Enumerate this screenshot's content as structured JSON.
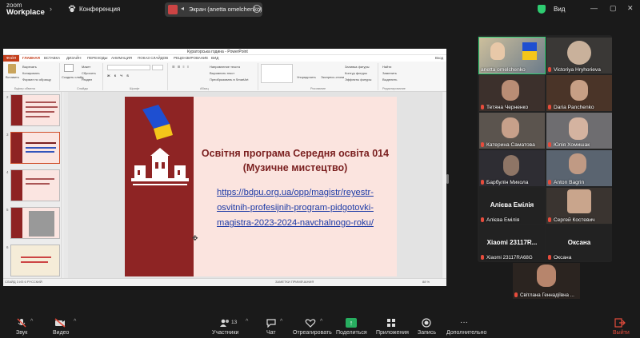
{
  "app": {
    "logo_line1": "zoom",
    "logo_line2": "Workplace",
    "conference_label": "Конференция",
    "share_label": "Экран (anetta omelchenko)",
    "view_label": "Вид",
    "accent_green": "#2ecc71",
    "leave_color": "#e74c3c"
  },
  "ppt": {
    "window_title": "Кураторська година - PowerPoint",
    "file_tab": "ФАЙЛ",
    "tabs": [
      "ГЛАВНАЯ",
      "ВСТАВКА",
      "ДИЗАЙН",
      "ПЕРЕХОДЫ",
      "АНИМАЦИЯ",
      "ПОКАЗ СЛАЙДОВ",
      "РЕЦЕНЗИРОВАНИЕ",
      "ВИД"
    ],
    "signin": "Вход",
    "ribbon": {
      "paste": "Вставить",
      "cut": "Вырезать",
      "copy": "Копировать",
      "format": "Формат по образцу",
      "new_slide": "Создать слайд",
      "layout": "Макет",
      "reset": "Сбросить",
      "section": "Раздел",
      "text_dir": "Направление текста",
      "align_text": "Выровнять текст",
      "smartart": "Преобразовать в SmartArt",
      "arrange": "Упорядочить",
      "quick_styles": "Экспресс-стили",
      "shape_fill": "Заливка фигуры",
      "shape_outline": "Контур фигуры",
      "shape_effects": "Эффекты фигуры",
      "find": "Найти",
      "replace": "Заменить",
      "select": "Выделить",
      "group_clipboard": "Буфер обмена",
      "group_slides": "Слайды",
      "group_font": "Шрифт",
      "group_paragraph": "Абзац",
      "group_drawing": "Рисование",
      "group_editing": "Редактирование"
    },
    "thumb_numbers": [
      "2",
      "3",
      "4",
      "5",
      "6"
    ],
    "status_left": "СЛАЙД 3 ИЗ 6    РУССКИЙ",
    "status_right": "ЗАМЕТКИ    ПРИМЕЧАНИЯ",
    "zoom": "88 %"
  },
  "slide": {
    "title_line1": "Освітня програма Середня освіта 014",
    "title_line2": "(Музичне мистецтво)",
    "link_line1": "https://bdpu.org.ua/opp/magistr/reyestr-",
    "link_line2": "osvitnih-profesijnih-program-pidgotovki-",
    "link_line3": "magistra-2023-2024-navchalnogo-roku/"
  },
  "participants": [
    {
      "name": "anetta omelchenko",
      "mic_off": false
    },
    {
      "name": "Victoriya Hryhorieva",
      "mic_off": true
    },
    {
      "name": "Тетяна Черненко",
      "mic_off": true
    },
    {
      "name": "Daria Panchenko",
      "mic_off": true
    },
    {
      "name": "Катерина Саматова",
      "mic_off": true
    },
    {
      "name": "Юлія Хомишак",
      "mic_off": true
    },
    {
      "name": "Барбулін Микола",
      "mic_off": true
    },
    {
      "name": "Anton Bagrin",
      "mic_off": true
    },
    {
      "name": "Алієва Емілія",
      "big": "Алієва Емілія",
      "mic_off": true
    },
    {
      "name": "Сергей Костевич",
      "mic_off": true
    },
    {
      "name": "Xiaomi 23117RA68G",
      "big": "Xiaomi 23117R...",
      "mic_off": true
    },
    {
      "name": "Оксана",
      "big": "Оксана",
      "mic_off": true
    },
    {
      "name": "Світлана Геннадіївна ...",
      "mic_off": true
    }
  ],
  "toolbar": {
    "audio": "Звук",
    "video": "Видео",
    "participants": "Участники",
    "participants_count": "13",
    "chat": "Чат",
    "react": "Отреагировать",
    "share": "Поделиться",
    "apps": "Приложения",
    "record": "Запись",
    "more": "Дополнительно",
    "leave": "Выйти"
  }
}
